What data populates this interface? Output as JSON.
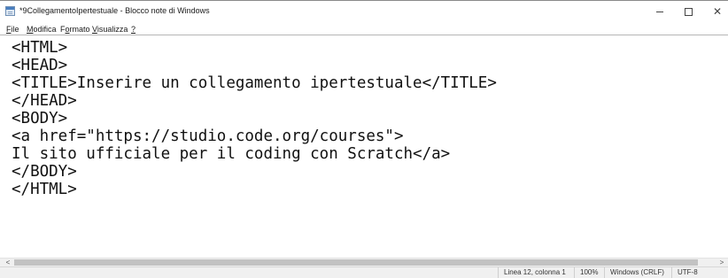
{
  "window": {
    "title": "*9CollegamentoIpertestuale - Blocco note di Windows",
    "minimize_icon": "minimize-icon",
    "maximize_icon": "maximize-icon",
    "close_glyph": "✕"
  },
  "menu": {
    "file": {
      "mnemonic": "F",
      "rest": "ile"
    },
    "modifica": {
      "mnemonic": "M",
      "rest": "odifica"
    },
    "formato": {
      "pre": "F",
      "mnemonic": "o",
      "rest": "rmato"
    },
    "visualizza": {
      "mnemonic": "V",
      "rest": "isualizza"
    },
    "help": {
      "mnemonic": "?"
    }
  },
  "editor": {
    "lines": [
      "<HTML>",
      "<HEAD>",
      "<TITLE>Inserire un collegamento ipertestuale</TITLE>",
      "</HEAD>",
      "<BODY>",
      "<a href=\"https://studio.code.org/courses\">",
      "Il sito ufficiale per il coding con Scratch</a>",
      "</BODY>",
      "</HTML>"
    ]
  },
  "scrollbar": {
    "left_arrow": "<",
    "right_arrow": ">"
  },
  "status": {
    "position": "Linea 12, colonna 1",
    "zoom": "100%",
    "line_ending": "Windows (CRLF)",
    "encoding": "UTF-8"
  }
}
